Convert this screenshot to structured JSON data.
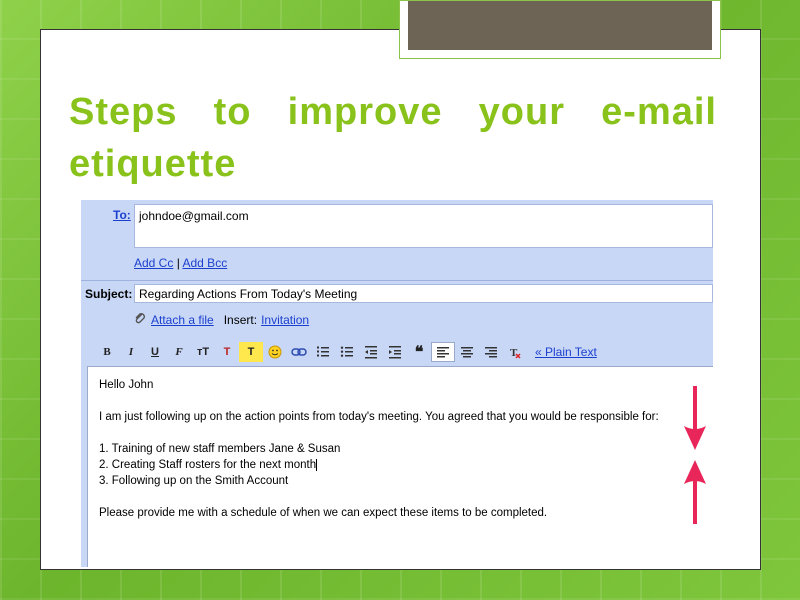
{
  "slide": {
    "title": "Steps to improve your e-mail etiquette"
  },
  "email": {
    "to_label": "To:",
    "to_value": "johndoe@gmail.com",
    "add_cc": "Add Cc",
    "cc_sep": "|",
    "add_bcc": "Add Bcc",
    "subject_label": "Subject:",
    "subject_value": "Regarding Actions From Today's Meeting",
    "attach_label": "Attach a file",
    "insert_label": "Insert:",
    "invitation_label": "Invitation",
    "toolbar": {
      "bold": "B",
      "italic": "I",
      "underline": "U",
      "font": "F",
      "size": "тT",
      "text_color": "T",
      "highlight": "T",
      "plain_text": "« Plain Text"
    },
    "body": {
      "greeting": "Hello John",
      "line1": "I am just following up on the action points from today's meeting. You agreed that you would be responsible for:",
      "item1": "1. Training of new staff members Jane & Susan",
      "item2": "2. Creating Staff rosters for the next month",
      "item3": "3. Following up on the Smith Account",
      "closing": "Please provide me with a schedule of when we can expect these items to be completed."
    }
  },
  "colors": {
    "title": "#88c21a",
    "arrow": "#e8265a",
    "panel": "#c9d7f6",
    "link": "#1a3fcf"
  }
}
